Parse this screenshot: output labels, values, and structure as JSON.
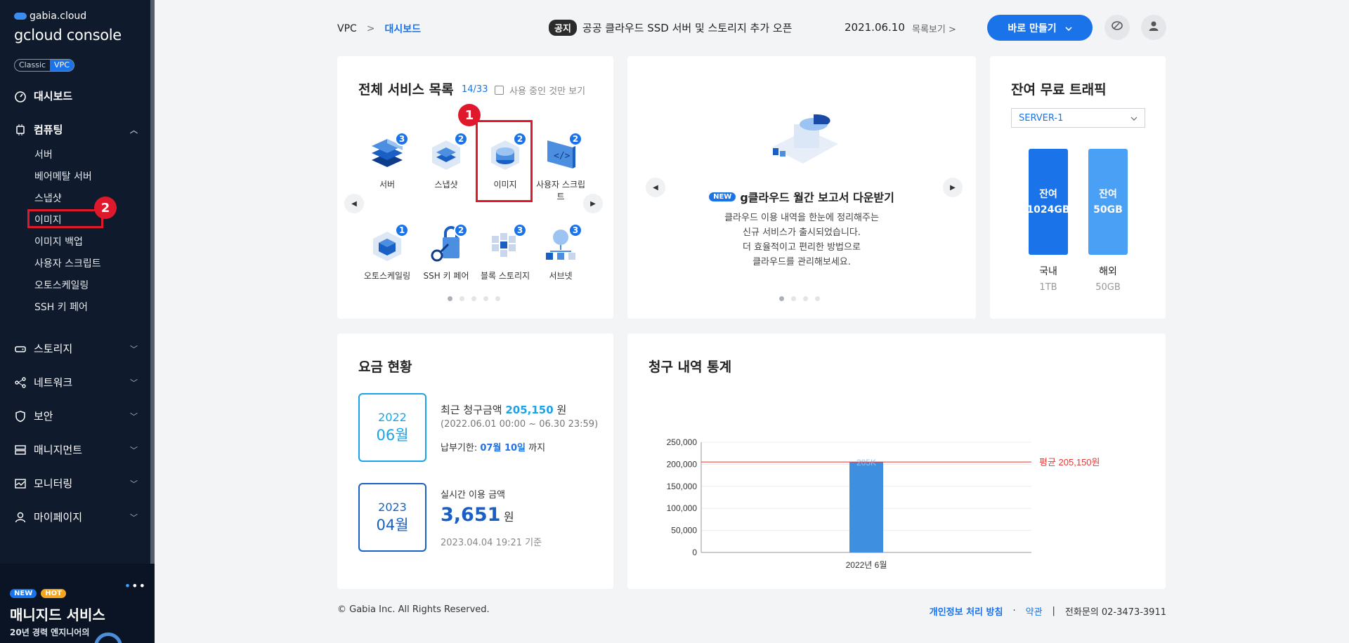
{
  "sidebar": {
    "logo_small": "gabia.cloud",
    "logo_big": "gcloud console",
    "env": [
      "Classic",
      "VPC"
    ],
    "dashboard": "대시보드",
    "computing": {
      "label": "컴퓨팅",
      "items": [
        "서버",
        "베어메탈 서버",
        "스냅샷",
        "이미지",
        "이미지 백업",
        "사용자 스크립트",
        "오토스케일링",
        "SSH 키 페어"
      ]
    },
    "sections": [
      "스토리지",
      "네트워크",
      "보안",
      "매니지먼트",
      "모니터링",
      "마이페이지"
    ],
    "promo": {
      "tag_new": "NEW",
      "tag_hot": "HOT",
      "title": "매니지드 서비스",
      "subtitle": "20년 경력 엔지니어의"
    }
  },
  "annotations": {
    "one": "1",
    "two": "2"
  },
  "header": {
    "breadcrumb_root": "VPC",
    "breadcrumb_sep": ">",
    "breadcrumb_current": "대시보드",
    "notice_tag": "공지",
    "notice_text": "공공 클라우드 SSD 서버 및 스토리지 추가 오픈",
    "notice_date": "2021.06.10",
    "notice_more": "목록보기 >",
    "make_button": "바로 만들기"
  },
  "services": {
    "title": "전체 서비스 목록",
    "count": "14/33",
    "filter_label": "사용 중인 것만 보기",
    "items": [
      {
        "label": "서버",
        "count": "3"
      },
      {
        "label": "스냅샷",
        "count": "2"
      },
      {
        "label": "이미지",
        "count": "2"
      },
      {
        "label": "사용자 스크립트",
        "count": "2"
      },
      {
        "label": "오토스케일링",
        "count": "1"
      },
      {
        "label": "SSH 키 페어",
        "count": "2"
      },
      {
        "label": "블록 스토리지",
        "count": "3"
      },
      {
        "label": "서브넷",
        "count": "3"
      }
    ]
  },
  "banner": {
    "tag": "NEW",
    "title": "g클라우드 월간 보고서 다운받기",
    "lines": [
      "클라우드 이용 내역을 한눈에 정리해주는",
      "신규 서비스가 출시되었습니다.",
      "더 효율적이고 편리한 방법으로",
      "클라우드를 관리해보세요."
    ]
  },
  "traffic": {
    "title": "잔여 무료 트래픽",
    "select_value": "SERVER-1",
    "bars": [
      {
        "line1": "잔여",
        "line2": "1024GB",
        "label": "국내",
        "sub": "1TB",
        "color": "#1a73e8"
      },
      {
        "line1": "잔여",
        "line2": "50GB",
        "label": "해외",
        "sub": "50GB",
        "color": "#4aa0f5"
      }
    ]
  },
  "fees": {
    "title": "요금 현황",
    "recent": {
      "year": "2022",
      "month": "06월",
      "label": "최근 청구금액",
      "amount": "205,150",
      "unit": "원",
      "period": "(2022.06.01 00:00 ~ 06.30 23:59)",
      "due_label": "납부기한:",
      "due_date": "07월 10일",
      "due_suffix": "까지"
    },
    "realtime": {
      "year": "2023",
      "month": "04월",
      "label": "실시간 이용 금액",
      "amount": "3,651",
      "unit": "원",
      "asof": "2023.04.04 19:21 기준"
    }
  },
  "billing": {
    "title": "청구 내역 통계",
    "avg_label": "평균 205,150원",
    "bar_label": "205K"
  },
  "chart_data": {
    "type": "bar",
    "categories": [
      "2022년 6월"
    ],
    "values": [
      205150
    ],
    "title": "청구 내역 통계",
    "ylim": [
      0,
      250000
    ],
    "yticks": [
      "250,000",
      "200,000",
      "150,000",
      "100,000",
      "50,000",
      "0"
    ],
    "reference_line": 205150
  },
  "footer": {
    "copyright": "© Gabia Inc. All Rights Reserved.",
    "privacy": "개인정보 처리 방침",
    "dot": "·",
    "terms": "약관",
    "bar": "|",
    "contact": "전화문의  02-3473-3911"
  }
}
